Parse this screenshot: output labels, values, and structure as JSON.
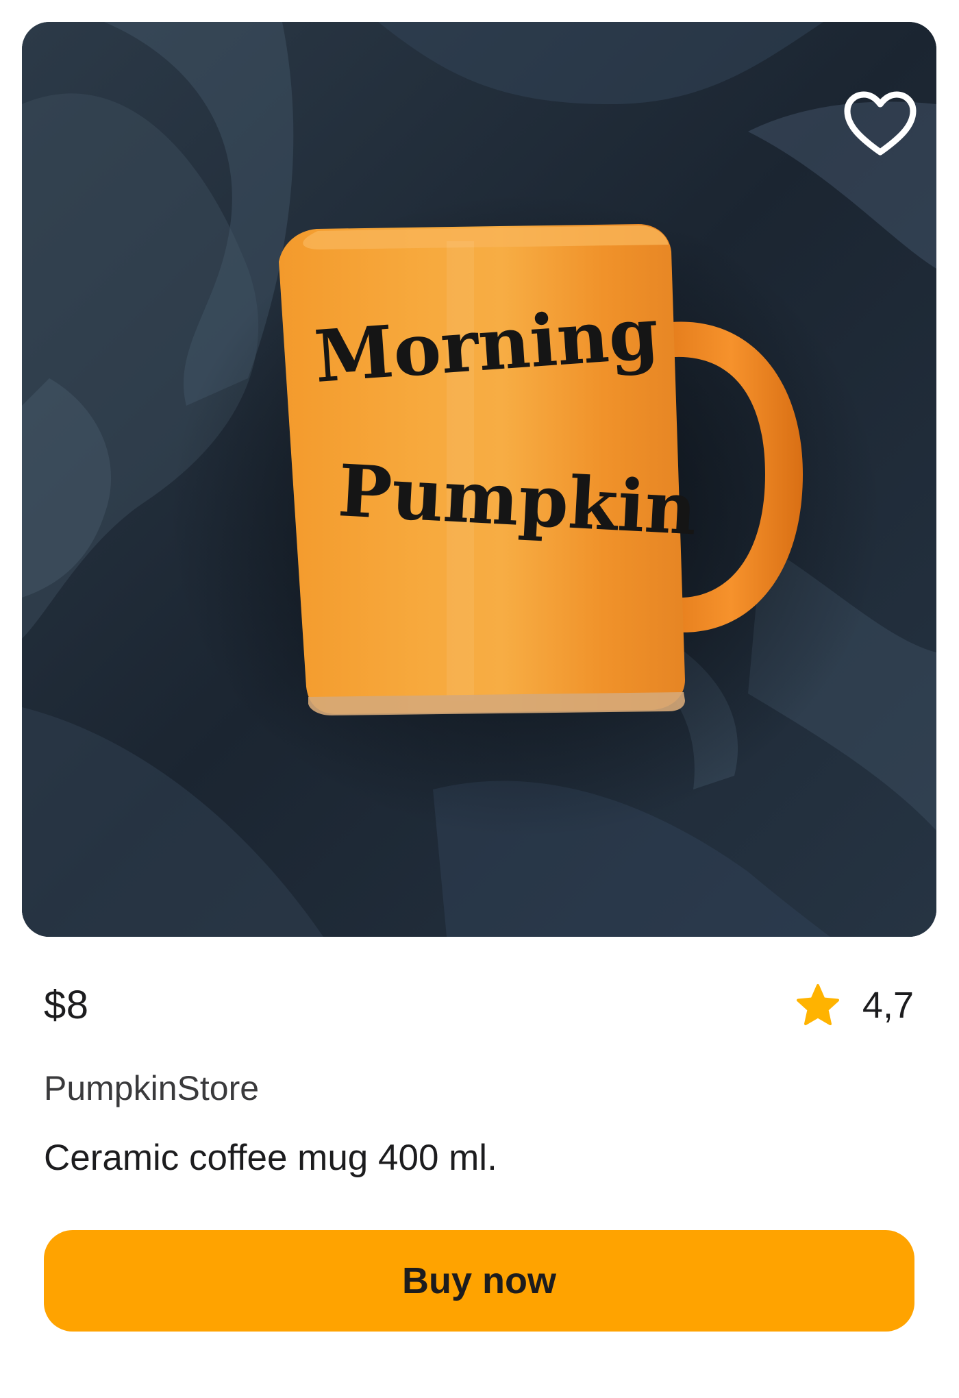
{
  "product": {
    "image_alt": "Orange mug on dark linen",
    "mug_print_line1": "Morning",
    "mug_print_line2": "Pumpkin",
    "price": "$8",
    "rating": "4,7",
    "store": "PumpkinStore",
    "title": "Ceramic coffee mug 400 ml."
  },
  "actions": {
    "buy_label": "Buy now",
    "favorite_icon": "heart-outline-icon",
    "rating_icon": "star-icon"
  },
  "colors": {
    "accent": "#ffa300",
    "star": "#ffb300",
    "text": "#1c1c1e",
    "mug": "#f5962a",
    "fabric": "#1f2a36"
  }
}
